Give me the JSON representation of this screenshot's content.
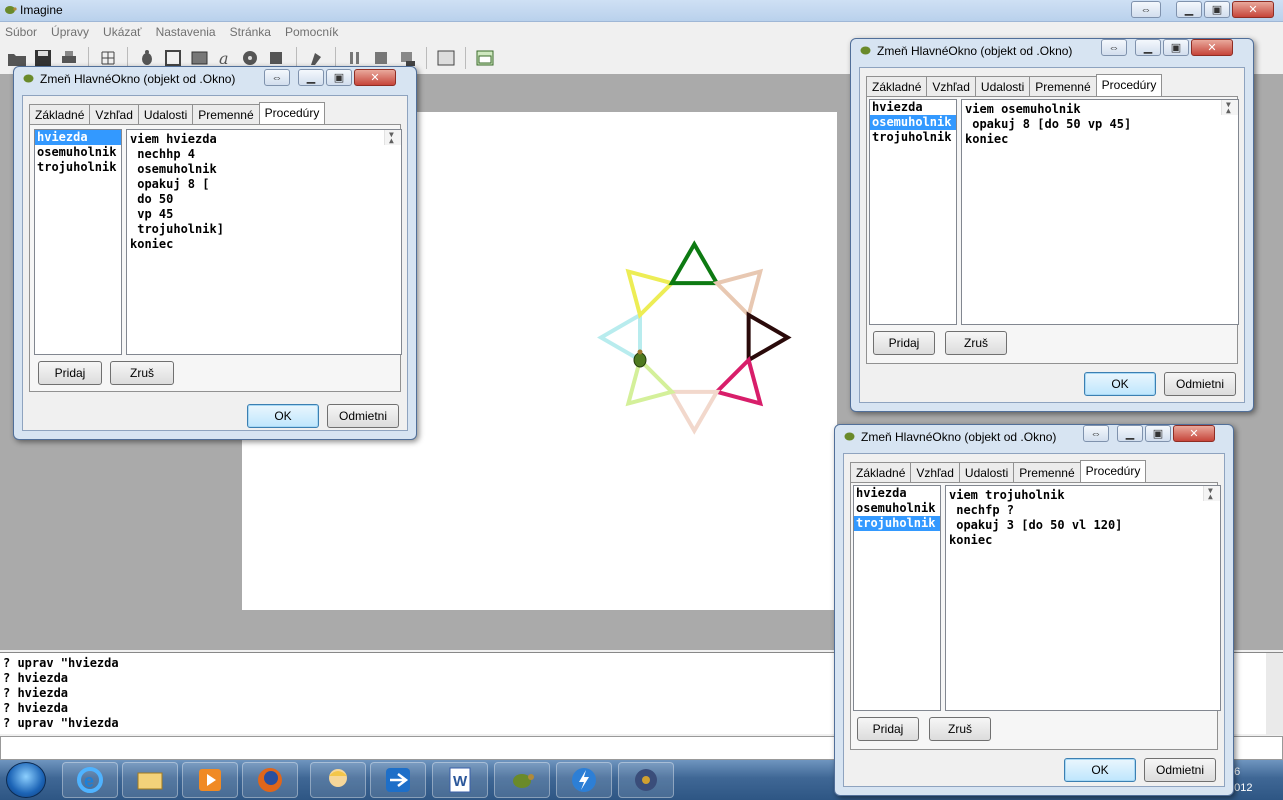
{
  "app": {
    "title": "Imagine",
    "menu": [
      "Súbor",
      "Úpravy",
      "Ukázať",
      "Nastavenia",
      "Stránka",
      "Pomocník"
    ]
  },
  "icons": {
    "app": "turtle-icon",
    "minimize": "minimize-icon",
    "maximize": "maximize-icon",
    "close": "close-icon",
    "restore": "restore-icon"
  },
  "dialog_common": {
    "title": "Zmeň HlavnéOkno (objekt od .Okno)",
    "tabs": [
      "Základné",
      "Vzhľad",
      "Udalosti",
      "Premenné",
      "Procedúry"
    ],
    "add_label": "Pridaj",
    "remove_label": "Zruš",
    "ok_label": "OK",
    "cancel_label": "Odmietni",
    "procedures": [
      "hviezda",
      "osemuholnik",
      "trojuholnik"
    ]
  },
  "dialog_left": {
    "selected": 0,
    "code": [
      "viem hviezda",
      " nechhp 4",
      " osemuholnik",
      " opakuj 8 [",
      " do 50",
      " vp 45",
      " trojuholnik]",
      "koniec"
    ]
  },
  "dialog_right_top": {
    "selected": 1,
    "code": [
      "viem osemuholnik",
      " opakuj 8 [do 50 vp 45]",
      "koniec"
    ]
  },
  "dialog_right_bottom": {
    "selected": 2,
    "code": [
      "viem trojuholnik",
      " nechfp ?",
      " opakuj 3 [do 50 vl 120]",
      "koniec"
    ]
  },
  "history": [
    "? uprav \"hviezda",
    "? hviezda",
    "? hviezda",
    "? hviezda",
    "? uprav \"hviezda"
  ],
  "star_colors": [
    "#b8ecee",
    "#eded55",
    "#0d7a12",
    "#e8c8b2",
    "#2a0a0a",
    "#d81e6a",
    "#f2d8cc",
    "#d4f09a"
  ],
  "taskbar": {
    "items": [
      "internet-explorer-icon",
      "file-explorer-icon",
      "media-player-icon",
      "firefox-icon",
      "avatar-icon",
      "teamviewer-icon",
      "word-icon",
      "imagine-icon",
      "thunder-icon",
      "media-icon"
    ],
    "clock_line1": "06",
    "clock_line2": "2012"
  }
}
